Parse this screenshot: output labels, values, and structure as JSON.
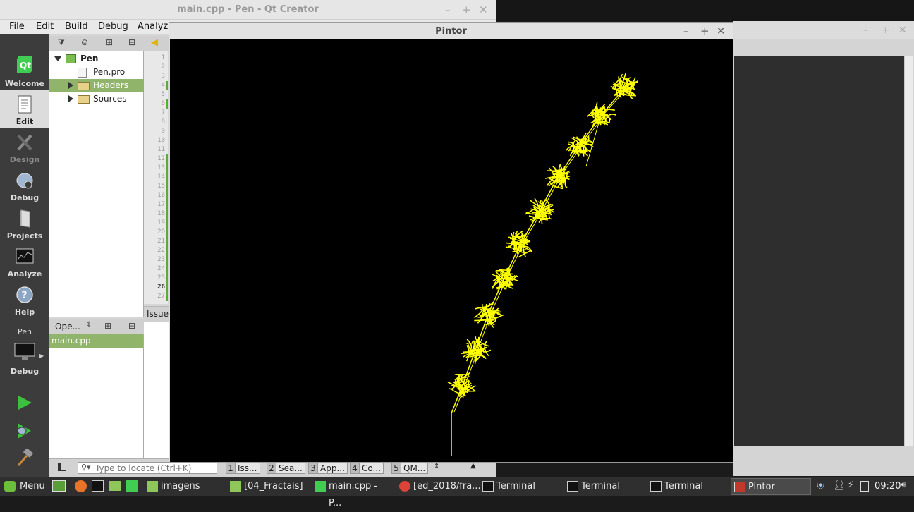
{
  "qt_creator": {
    "title": "main.cpp - Pen - Qt Creator",
    "menu": [
      "File",
      "Edit",
      "Build",
      "Debug",
      "Analyze"
    ],
    "modes": [
      {
        "label": "Welcome",
        "icon": "qt-logo-icon"
      },
      {
        "label": "Edit",
        "icon": "document-icon"
      },
      {
        "label": "Design",
        "icon": "pencil-ruler-icon"
      },
      {
        "label": "Debug",
        "icon": "bug-icon"
      },
      {
        "label": "Projects",
        "icon": "projects-icon"
      },
      {
        "label": "Analyze",
        "icon": "analyze-icon"
      },
      {
        "label": "Help",
        "icon": "help-icon"
      }
    ],
    "kit": {
      "project": "Pen",
      "config": "Debug"
    },
    "project_tree": [
      {
        "label": "Pen",
        "level": 0,
        "expanded": true
      },
      {
        "label": "Pen.pro",
        "level": 1
      },
      {
        "label": "Headers",
        "level": 1,
        "selected": true
      },
      {
        "label": "Sources",
        "level": 1
      }
    ],
    "open_docs": {
      "selector": "Ope...",
      "files": [
        "main.cpp"
      ]
    },
    "line_numbers": [
      "1",
      "2",
      "3",
      "4",
      "5",
      "6",
      "7",
      "8",
      "9",
      "10",
      "11",
      "12",
      "13",
      "14",
      "15",
      "16",
      "17",
      "18",
      "19",
      "20",
      "21",
      "22",
      "23",
      "24",
      "25",
      "26",
      "27"
    ],
    "current_line": "26",
    "issues_label": "Issue",
    "locator_placeholder": "Type to locate (Ctrl+K)",
    "output_tabs": [
      {
        "num": "1",
        "label": "Iss..."
      },
      {
        "num": "2",
        "label": "Sea..."
      },
      {
        "num": "3",
        "label": "App..."
      },
      {
        "num": "4",
        "label": "Co..."
      },
      {
        "num": "5",
        "label": "QM..."
      }
    ]
  },
  "pintor": {
    "title": "Pintor",
    "stroke_color": "#ffff00",
    "background": "#000000"
  },
  "taskbar": {
    "menu_label": "Menu",
    "tasks": [
      "imagens",
      "[04_Fractais]",
      "main.cpp - P...",
      "[ed_2018/fra...",
      "Terminal",
      "Terminal",
      "Terminal",
      "Pintor"
    ],
    "active_task": "Pintor",
    "clock": "09:20"
  }
}
